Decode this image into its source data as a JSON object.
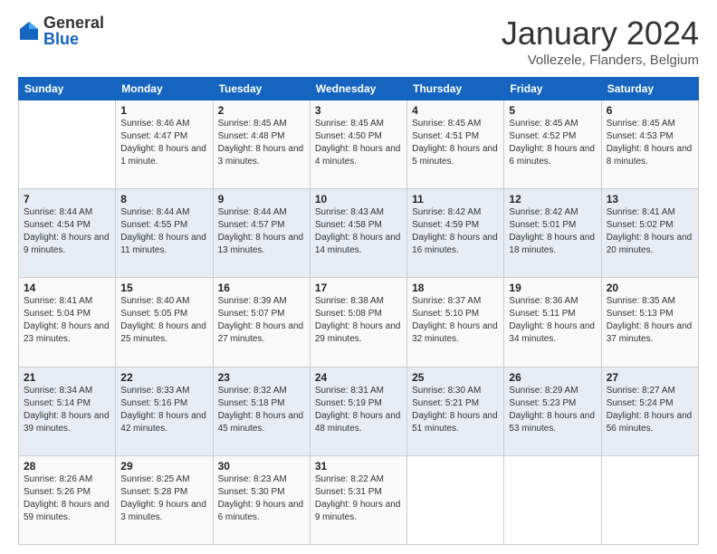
{
  "logo": {
    "general": "General",
    "blue": "Blue"
  },
  "title": "January 2024",
  "location": "Vollezele, Flanders, Belgium",
  "weekdays": [
    "Sunday",
    "Monday",
    "Tuesday",
    "Wednesday",
    "Thursday",
    "Friday",
    "Saturday"
  ],
  "weeks": [
    [
      {
        "day": "",
        "sunrise": "",
        "sunset": "",
        "daylight": ""
      },
      {
        "day": "1",
        "sunrise": "Sunrise: 8:46 AM",
        "sunset": "Sunset: 4:47 PM",
        "daylight": "Daylight: 8 hours and 1 minute."
      },
      {
        "day": "2",
        "sunrise": "Sunrise: 8:45 AM",
        "sunset": "Sunset: 4:48 PM",
        "daylight": "Daylight: 8 hours and 3 minutes."
      },
      {
        "day": "3",
        "sunrise": "Sunrise: 8:45 AM",
        "sunset": "Sunset: 4:50 PM",
        "daylight": "Daylight: 8 hours and 4 minutes."
      },
      {
        "day": "4",
        "sunrise": "Sunrise: 8:45 AM",
        "sunset": "Sunset: 4:51 PM",
        "daylight": "Daylight: 8 hours and 5 minutes."
      },
      {
        "day": "5",
        "sunrise": "Sunrise: 8:45 AM",
        "sunset": "Sunset: 4:52 PM",
        "daylight": "Daylight: 8 hours and 6 minutes."
      },
      {
        "day": "6",
        "sunrise": "Sunrise: 8:45 AM",
        "sunset": "Sunset: 4:53 PM",
        "daylight": "Daylight: 8 hours and 8 minutes."
      }
    ],
    [
      {
        "day": "7",
        "sunrise": "Sunrise: 8:44 AM",
        "sunset": "Sunset: 4:54 PM",
        "daylight": "Daylight: 8 hours and 9 minutes."
      },
      {
        "day": "8",
        "sunrise": "Sunrise: 8:44 AM",
        "sunset": "Sunset: 4:55 PM",
        "daylight": "Daylight: 8 hours and 11 minutes."
      },
      {
        "day": "9",
        "sunrise": "Sunrise: 8:44 AM",
        "sunset": "Sunset: 4:57 PM",
        "daylight": "Daylight: 8 hours and 13 minutes."
      },
      {
        "day": "10",
        "sunrise": "Sunrise: 8:43 AM",
        "sunset": "Sunset: 4:58 PM",
        "daylight": "Daylight: 8 hours and 14 minutes."
      },
      {
        "day": "11",
        "sunrise": "Sunrise: 8:42 AM",
        "sunset": "Sunset: 4:59 PM",
        "daylight": "Daylight: 8 hours and 16 minutes."
      },
      {
        "day": "12",
        "sunrise": "Sunrise: 8:42 AM",
        "sunset": "Sunset: 5:01 PM",
        "daylight": "Daylight: 8 hours and 18 minutes."
      },
      {
        "day": "13",
        "sunrise": "Sunrise: 8:41 AM",
        "sunset": "Sunset: 5:02 PM",
        "daylight": "Daylight: 8 hours and 20 minutes."
      }
    ],
    [
      {
        "day": "14",
        "sunrise": "Sunrise: 8:41 AM",
        "sunset": "Sunset: 5:04 PM",
        "daylight": "Daylight: 8 hours and 23 minutes."
      },
      {
        "day": "15",
        "sunrise": "Sunrise: 8:40 AM",
        "sunset": "Sunset: 5:05 PM",
        "daylight": "Daylight: 8 hours and 25 minutes."
      },
      {
        "day": "16",
        "sunrise": "Sunrise: 8:39 AM",
        "sunset": "Sunset: 5:07 PM",
        "daylight": "Daylight: 8 hours and 27 minutes."
      },
      {
        "day": "17",
        "sunrise": "Sunrise: 8:38 AM",
        "sunset": "Sunset: 5:08 PM",
        "daylight": "Daylight: 8 hours and 29 minutes."
      },
      {
        "day": "18",
        "sunrise": "Sunrise: 8:37 AM",
        "sunset": "Sunset: 5:10 PM",
        "daylight": "Daylight: 8 hours and 32 minutes."
      },
      {
        "day": "19",
        "sunrise": "Sunrise: 8:36 AM",
        "sunset": "Sunset: 5:11 PM",
        "daylight": "Daylight: 8 hours and 34 minutes."
      },
      {
        "day": "20",
        "sunrise": "Sunrise: 8:35 AM",
        "sunset": "Sunset: 5:13 PM",
        "daylight": "Daylight: 8 hours and 37 minutes."
      }
    ],
    [
      {
        "day": "21",
        "sunrise": "Sunrise: 8:34 AM",
        "sunset": "Sunset: 5:14 PM",
        "daylight": "Daylight: 8 hours and 39 minutes."
      },
      {
        "day": "22",
        "sunrise": "Sunrise: 8:33 AM",
        "sunset": "Sunset: 5:16 PM",
        "daylight": "Daylight: 8 hours and 42 minutes."
      },
      {
        "day": "23",
        "sunrise": "Sunrise: 8:32 AM",
        "sunset": "Sunset: 5:18 PM",
        "daylight": "Daylight: 8 hours and 45 minutes."
      },
      {
        "day": "24",
        "sunrise": "Sunrise: 8:31 AM",
        "sunset": "Sunset: 5:19 PM",
        "daylight": "Daylight: 8 hours and 48 minutes."
      },
      {
        "day": "25",
        "sunrise": "Sunrise: 8:30 AM",
        "sunset": "Sunset: 5:21 PM",
        "daylight": "Daylight: 8 hours and 51 minutes."
      },
      {
        "day": "26",
        "sunrise": "Sunrise: 8:29 AM",
        "sunset": "Sunset: 5:23 PM",
        "daylight": "Daylight: 8 hours and 53 minutes."
      },
      {
        "day": "27",
        "sunrise": "Sunrise: 8:27 AM",
        "sunset": "Sunset: 5:24 PM",
        "daylight": "Daylight: 8 hours and 56 minutes."
      }
    ],
    [
      {
        "day": "28",
        "sunrise": "Sunrise: 8:26 AM",
        "sunset": "Sunset: 5:26 PM",
        "daylight": "Daylight: 8 hours and 59 minutes."
      },
      {
        "day": "29",
        "sunrise": "Sunrise: 8:25 AM",
        "sunset": "Sunset: 5:28 PM",
        "daylight": "Daylight: 9 hours and 3 minutes."
      },
      {
        "day": "30",
        "sunrise": "Sunrise: 8:23 AM",
        "sunset": "Sunset: 5:30 PM",
        "daylight": "Daylight: 9 hours and 6 minutes."
      },
      {
        "day": "31",
        "sunrise": "Sunrise: 8:22 AM",
        "sunset": "Sunset: 5:31 PM",
        "daylight": "Daylight: 9 hours and 9 minutes."
      },
      {
        "day": "",
        "sunrise": "",
        "sunset": "",
        "daylight": ""
      },
      {
        "day": "",
        "sunrise": "",
        "sunset": "",
        "daylight": ""
      },
      {
        "day": "",
        "sunrise": "",
        "sunset": "",
        "daylight": ""
      }
    ]
  ]
}
